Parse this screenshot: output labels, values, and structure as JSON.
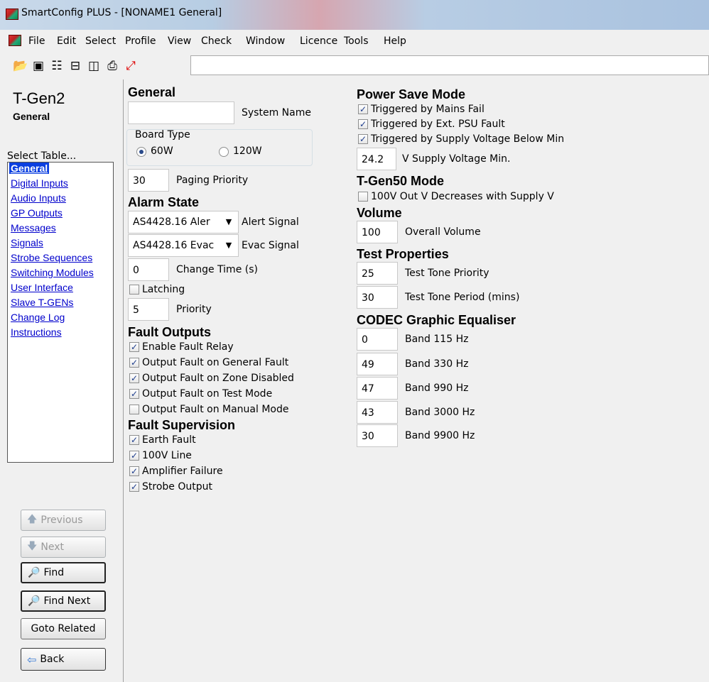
{
  "window": {
    "title": "SmartConfig PLUS - [NONAME1   General]"
  },
  "menu": [
    "File",
    "Edit",
    "Select",
    "Profile",
    "View",
    "Check",
    "Window",
    "Licence",
    "Tools",
    "Help"
  ],
  "sidebar": {
    "device": "T-Gen2",
    "page": "General",
    "select_label": "Select Table...",
    "items": [
      "General",
      "Digital Inputs",
      "Audio Inputs",
      "GP Outputs",
      "Messages",
      "Signals",
      "Strobe Sequences",
      "Switching Modules",
      "User Interface",
      "Slave T-GENs",
      "Change Log",
      "Instructions"
    ],
    "buttons": {
      "previous": "Previous",
      "next": "Next",
      "find": "Find",
      "find_next": "Find Next",
      "goto_related": "Goto Related",
      "back": "Back"
    }
  },
  "general": {
    "heading": "General",
    "system_name": {
      "value": "",
      "label": "System Name"
    },
    "board_type": {
      "label": "Board Type",
      "options": [
        "60W",
        "120W"
      ],
      "selected": "60W"
    },
    "paging_priority": {
      "value": "30",
      "label": "Paging Priority"
    }
  },
  "alarm_state": {
    "heading": "Alarm State",
    "alert_signal": {
      "value": "AS4428.16 Aler",
      "label": "Alert Signal"
    },
    "evac_signal": {
      "value": "AS4428.16 Evac",
      "label": "Evac Signal"
    },
    "change_time": {
      "value": "0",
      "label": "Change Time (s)"
    },
    "latching": {
      "label": "Latching",
      "checked": false
    },
    "priority": {
      "value": "5",
      "label": "Priority"
    }
  },
  "fault_outputs": {
    "heading": "Fault Outputs",
    "items": [
      {
        "label": "Enable Fault Relay",
        "checked": true
      },
      {
        "label": "Output Fault on General Fault",
        "checked": true
      },
      {
        "label": "Output Fault on Zone Disabled",
        "checked": true
      },
      {
        "label": "Output Fault on Test Mode",
        "checked": true
      },
      {
        "label": "Output Fault on Manual Mode",
        "checked": false
      }
    ]
  },
  "fault_supervision": {
    "heading": "Fault Supervision",
    "items": [
      {
        "label": "Earth Fault",
        "checked": true
      },
      {
        "label": "100V Line",
        "checked": true
      },
      {
        "label": "Amplifier Failure",
        "checked": true
      },
      {
        "label": "Strobe Output",
        "checked": true
      }
    ]
  },
  "power_save": {
    "heading": "Power Save Mode",
    "items": [
      {
        "label": "Triggered by Mains Fail",
        "checked": true
      },
      {
        "label": "Triggered by Ext. PSU Fault",
        "checked": true
      },
      {
        "label": "Triggered by Supply Voltage Below Min",
        "checked": true
      }
    ],
    "supply_min": {
      "value": "24.2",
      "label": "V Supply Voltage Min."
    }
  },
  "tgen50": {
    "heading": "T-Gen50 Mode",
    "item": {
      "label": "100V Out V Decreases with Supply V",
      "checked": false
    }
  },
  "volume": {
    "heading": "Volume",
    "overall": {
      "value": "100",
      "label": "Overall Volume"
    }
  },
  "test_properties": {
    "heading": "Test Properties",
    "tone_priority": {
      "value": "25",
      "label": "Test Tone Priority"
    },
    "tone_period": {
      "value": "30",
      "label": "Test Tone Period (mins)"
    }
  },
  "codec": {
    "heading": "CODEC Graphic Equaliser",
    "bands": [
      {
        "value": "0",
        "label": "Band 115 Hz"
      },
      {
        "value": "49",
        "label": "Band 330 Hz"
      },
      {
        "value": "47",
        "label": "Band 990 Hz"
      },
      {
        "value": "43",
        "label": "Band 3000 Hz"
      },
      {
        "value": "30",
        "label": "Band 9900 Hz"
      }
    ]
  }
}
